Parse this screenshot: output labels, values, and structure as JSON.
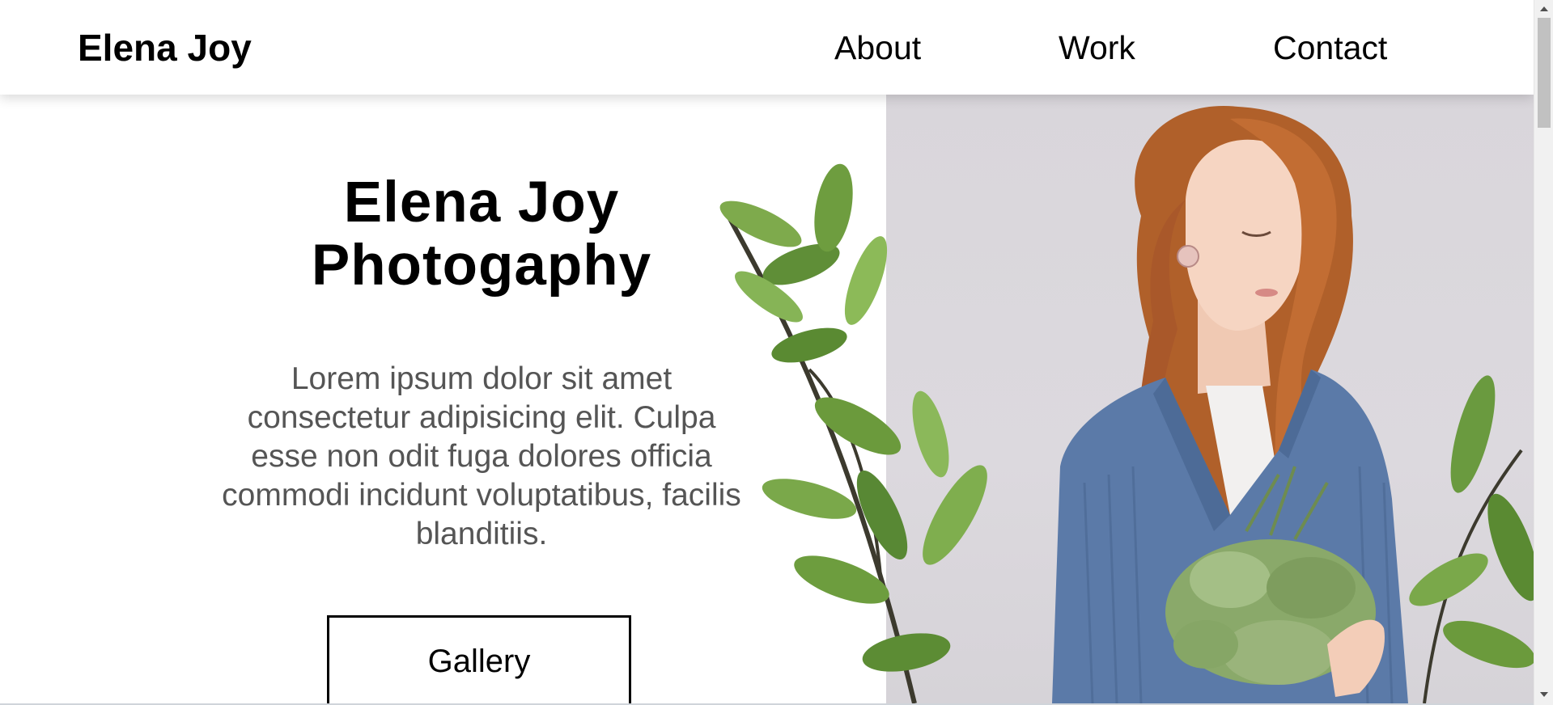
{
  "header": {
    "brand": "Elena Joy",
    "nav": {
      "about": "About",
      "work": "Work",
      "contact": "Contact"
    }
  },
  "hero": {
    "title_line1": "Elena Joy",
    "title_line2": "Photogaphy",
    "text": "Lorem ipsum dolor sit amet consectetur adipisicing elit. Culpa esse non odit fuga dolores officia commodi incidunt voluptatibus, facilis blanditiis.",
    "button_label": "Gallery"
  },
  "colors": {
    "text_primary": "#000000",
    "text_secondary": "#555555",
    "photo_background": "#d9d6db",
    "sweater": "#5b7aa8",
    "hair": "#b8642c",
    "leaf": "#6a9a3f"
  },
  "icons": {
    "scroll_up": "chevron-up-icon",
    "scroll_down": "chevron-down-icon"
  }
}
